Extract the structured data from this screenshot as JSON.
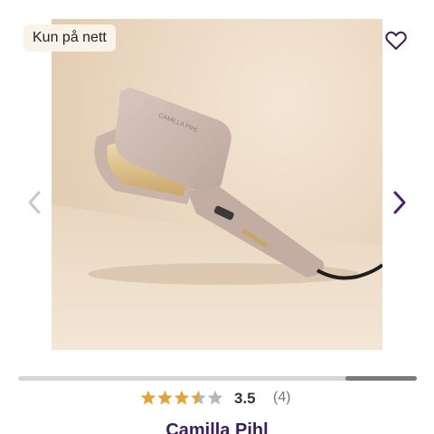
{
  "badge": {
    "label": "Kun på nett"
  },
  "product": {
    "brand": "Camilla Pihl",
    "image_text": "CAMILLA PIHL",
    "rating": {
      "value": "3.5",
      "count": "(4)",
      "stars_filled": 3.5,
      "stars_total": 5
    }
  },
  "gallery": {
    "scroll_position": 0.82,
    "scroll_thumb_size": 0.18
  },
  "icons": {
    "wishlist": "heart-outline-icon",
    "prev": "chevron-left-icon",
    "next": "chevron-right-icon",
    "star": "star-icon"
  },
  "colors": {
    "star_filled": "#e2a33c",
    "star_empty": "#b8b8b8",
    "brand_text": "#3b1d57",
    "arrow_active": "#4b1f6f",
    "arrow_disabled": "#c9c5d2"
  }
}
